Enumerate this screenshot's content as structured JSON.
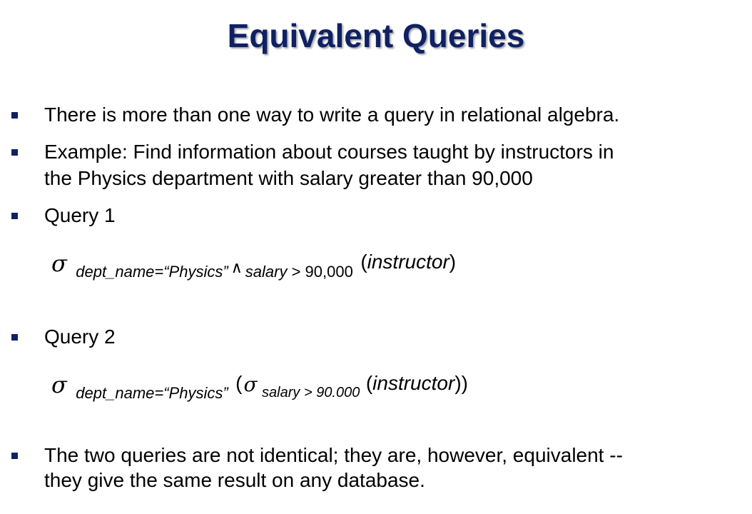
{
  "slide": {
    "title": "Equivalent Queries",
    "bullets": [
      "There is more than one way to write a query in relational algebra.",
      "Example:  Find information about courses taught by instructors in",
      "the Physics department with salary greater than 90,000",
      "Query 1",
      "Query 2",
      "The two queries are not identical; they are, however, equivalent --",
      "they give the same result on any database."
    ],
    "query1": {
      "sigma": "σ",
      "predicate_left": "dept_name=",
      "physics": "“Physics”",
      "and_symbol": "∧",
      "predicate_right_italic": "salary",
      "predicate_right_plain": " > 90,000",
      "relation": "instructor",
      "open_paren": "(",
      "close_paren": ")"
    },
    "query2": {
      "sigma": "σ",
      "predicate": "dept_name=",
      "physics": "“Physics”",
      "open_paren": "(",
      "inner_sigma": "σ",
      "inner_predicate": "salary > 90.000",
      "relation": "instructor",
      "close_parens": "))",
      "inner_open_paren": "("
    },
    "colors": {
      "title": "#0f2163",
      "bullet": "#0f2163",
      "text": "#000000"
    }
  }
}
